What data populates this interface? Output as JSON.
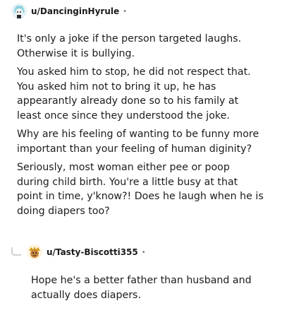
{
  "comments": [
    {
      "username": "u/DancinginHyrule",
      "separator": "•",
      "paragraphs": [
        "It's only a joke if the person targeted laughs. Otherwise it is bullying.",
        "You asked him to stop, he did not respect that. You asked him not to bring it up, he has appearantly already done so to his family at least once since they understood the joke.",
        "Why are his feeling of wanting to be funny more important than your feeling of human diginity?",
        "Seriously, most woman either pee or poop during child birth. You're a little busy at that point in time, y'know?! Does he laugh when he is doing diapers too?"
      ]
    },
    {
      "username": "u/Tasty-Biscotti355",
      "separator": "•",
      "paragraphs": [
        "Hope he's a better father than husband and actually does diapers."
      ]
    }
  ],
  "icons": {
    "avatar1": "snoo-avatar-icon",
    "avatar2": "snoo-avatar-icon",
    "reply": "reply-thread-icon"
  }
}
